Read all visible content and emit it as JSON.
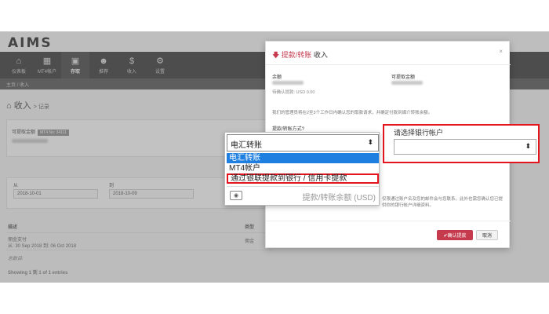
{
  "app": {
    "brand": "AIMS",
    "nav": [
      {
        "label": "仪表板",
        "icon": "home-icon",
        "glyph": "⌂"
      },
      {
        "label": "MT4帐户",
        "icon": "grid-icon",
        "glyph": "▦"
      },
      {
        "label": "存取",
        "icon": "cash-icon",
        "glyph": "▣"
      },
      {
        "label": "推荐",
        "icon": "users-icon",
        "glyph": "☻"
      },
      {
        "label": "收入",
        "icon": "dollar-icon",
        "glyph": "$"
      },
      {
        "label": "设置",
        "icon": "gear-icon",
        "glyph": "⚙"
      }
    ],
    "breadcrumb": "主页 / 收入",
    "page_title": "收入",
    "page_subtitle": "> 记录",
    "account_label": "可提取金额",
    "account_badge": "MT4 No: 34111",
    "date_from_label": "从",
    "date_from": "2018-10-01",
    "date_to_label": "到",
    "date_to": "2018-10-09",
    "table_headers": {
      "desc": "描述",
      "type": "类型"
    },
    "table_row": {
      "desc": "佣金支付",
      "range": "从: 30 Sep 2018 到: 06 Oct 2018",
      "type": "佣金"
    },
    "total_label": "总数目:",
    "showing": "Showing 1 到 1 of 1 entries"
  },
  "modal": {
    "title_prefix": "提款/转账",
    "title_rest": "收入",
    "close": "×",
    "balance_label": "余额",
    "pending_label": "待确认提款: USD 0.00",
    "available_label": "可提取金额",
    "notice": "我们的管理员将在2至3个工作日内确认您的取款请求，并确定付款到媒介转账余额。",
    "method_label": "提款/转账方式?",
    "bank_label": "请选择银行帐户",
    "footer_note": "仅限通过账户名及您的邮件会与您联系。此外也需您确认您已提供你的银行帐户详细资料。",
    "confirm_button": "✔确认提款",
    "cancel_button": "取消"
  },
  "dropdown": {
    "current": "电汇转账",
    "options": [
      "电汇转账",
      "MT4帐户",
      "通过银联提款到银行 / 信用卡提款"
    ],
    "balance_placeholder": "提款/转账余额 (USD)"
  }
}
